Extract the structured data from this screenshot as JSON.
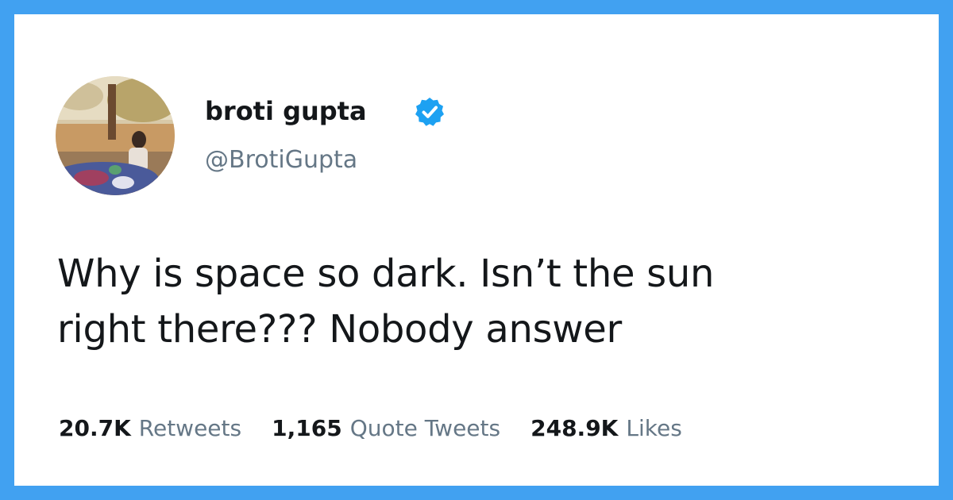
{
  "tweet": {
    "author": {
      "name": "broti gupta",
      "handle": "@BrotiGupta",
      "verified_icon": "verified-badge-icon"
    },
    "text_lines": [
      "Why is space so dark. Isn’t the sun",
      "right there??? Nobody answer"
    ],
    "stats": [
      {
        "value": "20.7K",
        "label": "Retweets"
      },
      {
        "value": "1,165",
        "label": "Quote Tweets"
      },
      {
        "value": "248.9K",
        "label": "Likes"
      }
    ]
  },
  "colors": {
    "frame_border": "#41a1f1",
    "verified_blue": "#1da1f2",
    "primary_text": "#14171a",
    "secondary_text": "#657786"
  }
}
